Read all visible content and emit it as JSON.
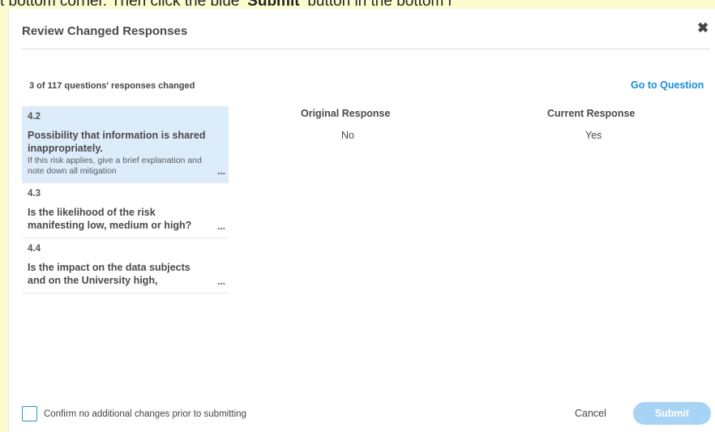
{
  "backdrop": {
    "text_before": "t bottom corner. Then click the blue ",
    "text_bold": "'Submit'",
    "text_after": " button in the bottom r"
  },
  "modal": {
    "title": "Review Changed Responses",
    "close_glyph": "✖",
    "summary": "3 of 117 questions' responses changed",
    "goto_label": "Go to Question",
    "columns": {
      "original_header": "Original Response",
      "current_header": "Current Response",
      "original_value": "No",
      "current_value": "Yes"
    },
    "questions": [
      {
        "number": "4.2",
        "text": "Possibility that information is shared inappropriately.",
        "description": "If this risk applies, give a brief explanation and note down all mitigation",
        "ellipsis": "...",
        "selected": true
      },
      {
        "number": "4.3",
        "text": "Is the likelihood of the risk manifesting low, medium or high?",
        "ellipsis": "...",
        "selected": false
      },
      {
        "number": "4.4",
        "text": "Is the impact on the data subjects and on the University high,",
        "ellipsis": "...",
        "selected": false
      }
    ],
    "footer": {
      "confirm_label": "Confirm no additional changes prior to submitting",
      "cancel_label": "Cancel",
      "submit_label": "Submit"
    }
  },
  "colors": {
    "accent": "#1a8fd8",
    "selected_bg": "#dcecfb",
    "submit_disabled": "#a9d3f5",
    "backdrop": "#fdfbd0"
  }
}
